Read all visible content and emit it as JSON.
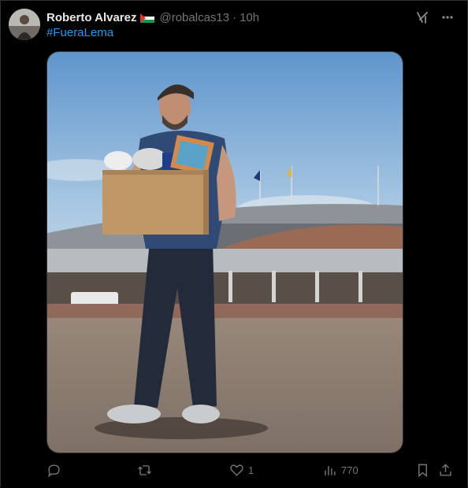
{
  "tweet": {
    "display_name": "Roberto Alvarez",
    "flag_icon": "palestine-flag-icon",
    "handle": "@robalcas13",
    "separator": "·",
    "time": "10h",
    "hashtag": "#FueraLema",
    "image_icon": "photo-man-carrying-box-stadium"
  },
  "actions": {
    "reply_count": "",
    "retweet_count": "",
    "like_count": "1",
    "views_count": "770"
  },
  "colors": {
    "background": "#000000",
    "text": "#e7e9ea",
    "muted": "#71767b",
    "link": "#1d9bf0"
  }
}
